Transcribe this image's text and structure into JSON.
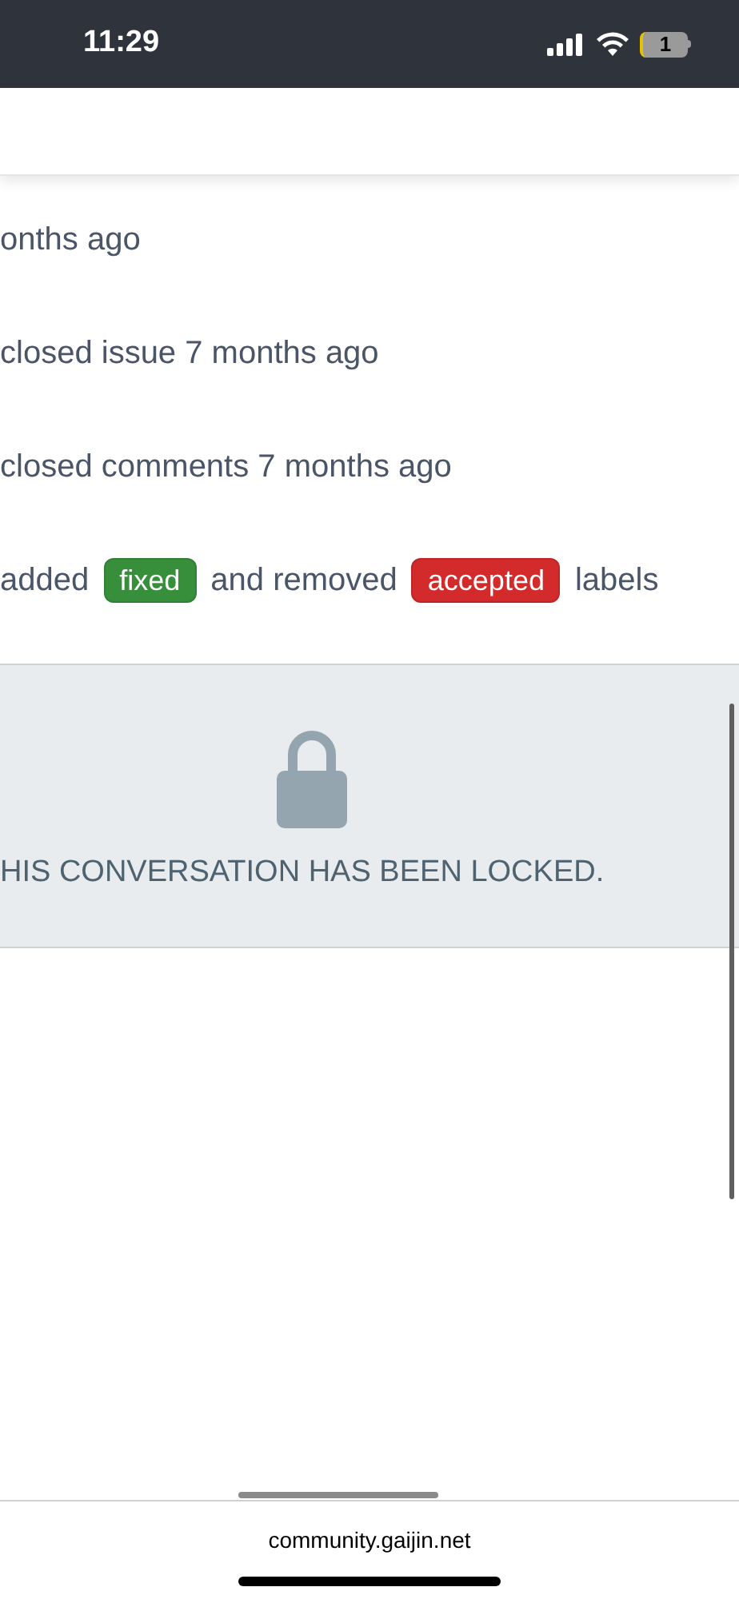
{
  "status_bar": {
    "time": "11:29",
    "battery": "1"
  },
  "activity": [
    {
      "segments": [
        {
          "kind": "text",
          "text": "onths ago"
        }
      ]
    },
    {
      "segments": [
        {
          "kind": "text",
          "text": "closed issue 7 months ago"
        }
      ]
    },
    {
      "segments": [
        {
          "kind": "text",
          "text": "closed comments 7 months ago"
        }
      ]
    },
    {
      "segments": [
        {
          "kind": "text",
          "text": "added"
        },
        {
          "kind": "label",
          "text": "fixed",
          "color": "#378f3b"
        },
        {
          "kind": "text",
          "text": "and removed"
        },
        {
          "kind": "label",
          "text": "accepted",
          "color": "#d32b2b"
        },
        {
          "kind": "text",
          "text": "labels"
        }
      ]
    }
  ],
  "locked_notice": {
    "text": "HIS CONVERSATION HAS BEEN LOCKED."
  },
  "browser_bar": {
    "url": "community.gaijin.net"
  }
}
